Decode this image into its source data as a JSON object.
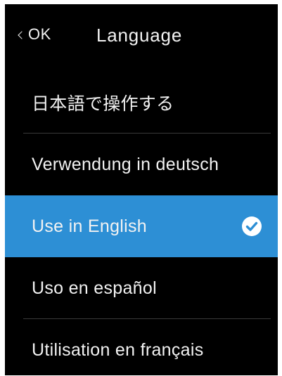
{
  "header": {
    "back_label": "OK",
    "title": "Language"
  },
  "languages": [
    {
      "label": "日本語で操作する",
      "selected": false
    },
    {
      "label": "Verwendung in deutsch",
      "selected": false
    },
    {
      "label": "Use in English",
      "selected": true
    },
    {
      "label": "Uso en español",
      "selected": false
    },
    {
      "label": "Utilisation en français",
      "selected": false
    }
  ],
  "colors": {
    "background": "#000000",
    "text": "#f2f2f2",
    "selected_background": "#2d8fd5",
    "divider": "#3a3a3a"
  },
  "icons": {
    "back": "chevron-left-icon",
    "selected": "check-circle-icon"
  }
}
